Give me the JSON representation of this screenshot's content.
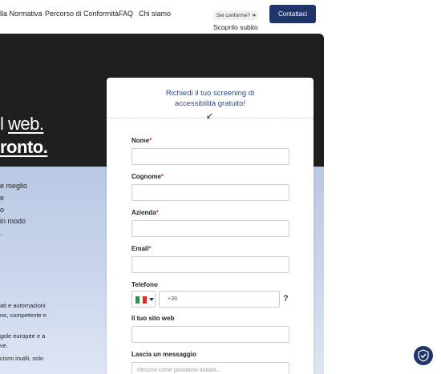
{
  "nav": {
    "links": [
      "lla Normativa",
      "Percorso di Conformità",
      "FAQ",
      "Chi siamo"
    ],
    "pill": "Sei conforme? ➜",
    "sub": "Scoprilo subito",
    "contact_label": "Contattaci"
  },
  "hero": {
    "line1_prefix": "l ",
    "line1_link": "web.",
    "line2": "ronto.",
    "body_lines": [
      "e meglio",
      "e",
      "o",
      "in modo",
      "."
    ],
    "small_lines": [
      "ati e automazioni",
      "no, competente e",
      "gole europee e a",
      "ve.",
      "cismi inutili, solo"
    ]
  },
  "form": {
    "title_line1": "Richiedi il tuo screening di",
    "title_line2": "accessibilità gratuito!",
    "fields": {
      "nome": "Nome",
      "cognome": "Cognome",
      "azienda": "Azienda",
      "email": "Email",
      "telefono": "Telefono",
      "sito": "Il tuo sito web",
      "messaggio": "Lascia un messaggio"
    },
    "required_mark": "*",
    "phone_prefix": "+39",
    "help": "?",
    "message_placeholder": "Descrivi come possiamo aiutarti..."
  },
  "colors": {
    "brand": "#1f3468",
    "required": "#d92c2c",
    "title": "#2f4a80"
  },
  "icons": [
    "arrow-down-icon",
    "italy-flag-icon",
    "chevron-down-icon",
    "help-icon",
    "accessibility-check-icon"
  ]
}
